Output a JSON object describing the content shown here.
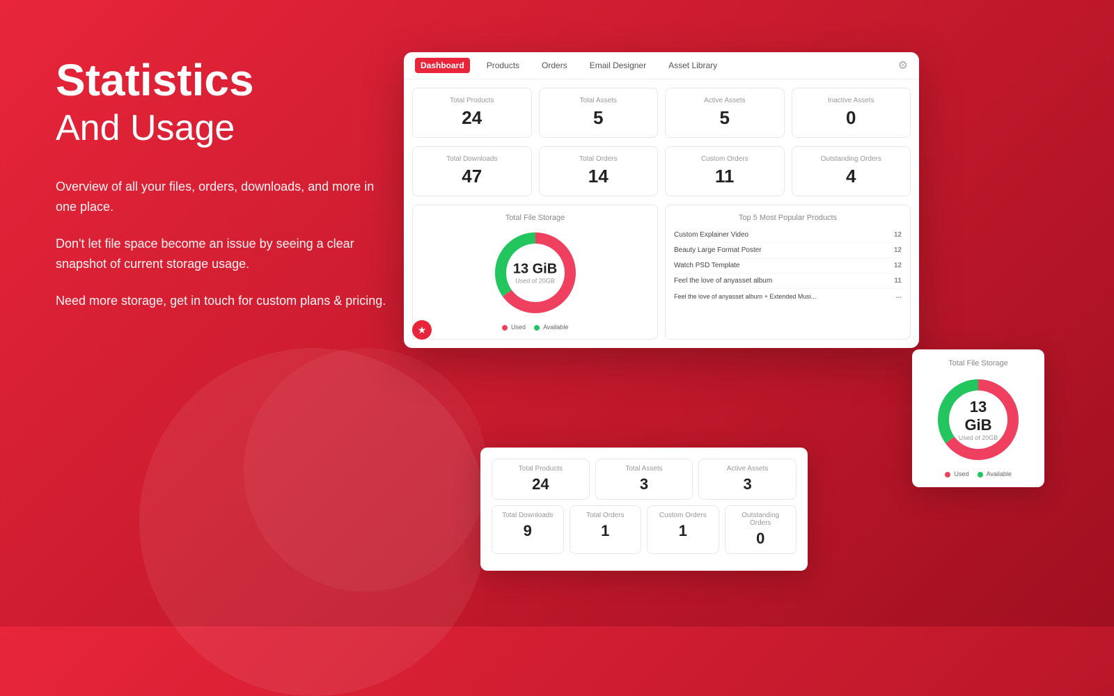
{
  "page": {
    "background": "#e8253a",
    "title": "Statistics",
    "subtitle": "And Usage",
    "descriptions": [
      "Overview of all your files, orders, downloads, and more in one place.",
      "Don't let file space become an issue by seeing a clear snapshot of current storage usage.",
      "Need more storage, get in touch for custom plans & pricing."
    ]
  },
  "nav": {
    "items": [
      "Dashboard",
      "Products",
      "Orders",
      "Email Designer",
      "Asset Library"
    ],
    "active": "Dashboard",
    "gear_icon": "⚙"
  },
  "stats_row1": [
    {
      "label": "Total Products",
      "value": "24"
    },
    {
      "label": "Total Assets",
      "value": "5"
    },
    {
      "label": "Active Assets",
      "value": "5"
    },
    {
      "label": "Inactive Assets",
      "value": "0"
    }
  ],
  "stats_row2": [
    {
      "label": "Total Downloads",
      "value": "47"
    },
    {
      "label": "Total Orders",
      "value": "14"
    },
    {
      "label": "Custom Orders",
      "value": "11"
    },
    {
      "label": "Outstanding Orders",
      "value": "4"
    }
  ],
  "storage": {
    "title": "Total File Storage",
    "used_label": "13 GiB",
    "used_sub": "Used of 20GB",
    "legend_used": "Used",
    "legend_available": "Available",
    "used_color": "#f04060",
    "available_color": "#22c55e",
    "used_pct": 65,
    "available_pct": 35
  },
  "popular_products": {
    "title": "Top 5 Most Popular Products",
    "items": [
      {
        "name": "Custom Explainer Video",
        "count": "12"
      },
      {
        "name": "Beauty Large Format Poster",
        "count": "12"
      },
      {
        "name": "Watch PSD Template",
        "count": "12"
      },
      {
        "name": "Feel the love of anyasset album",
        "count": "11"
      },
      {
        "name": "Feel the love of anyasset album + Extended Musi...",
        "count": "..."
      }
    ]
  },
  "secondary_stats_row1": [
    {
      "label": "Total Products",
      "value": "24"
    },
    {
      "label": "Total Assets",
      "value": "3"
    },
    {
      "label": "Active Assets",
      "value": "3"
    }
  ],
  "secondary_stats_row2": [
    {
      "label": "Total Downloads",
      "value": "9"
    },
    {
      "label": "Total Orders",
      "value": "1"
    },
    {
      "label": "Custom Orders",
      "value": "1"
    },
    {
      "label": "Outstanding Orders",
      "value": "0"
    }
  ],
  "floating_storage": {
    "title": "Total File Storage",
    "used_label": "13 GiB",
    "used_sub": "Used of 20GB",
    "legend_used": "Used",
    "legend_available": "Available"
  },
  "star_icon": "★"
}
